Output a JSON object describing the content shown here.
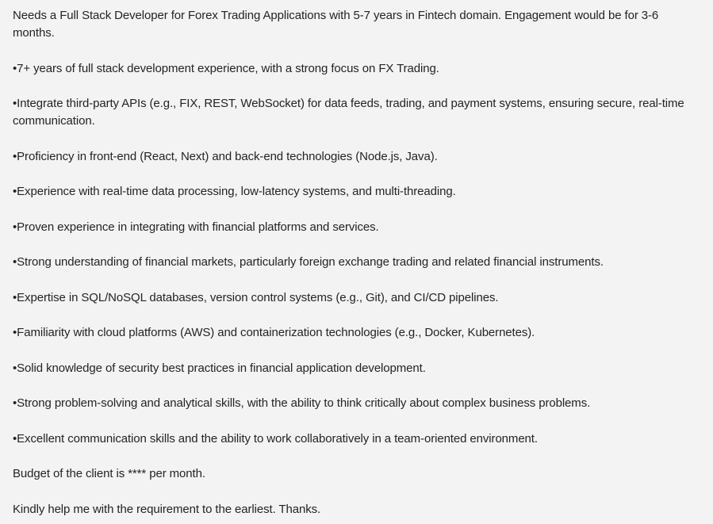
{
  "message": {
    "intro": "Needs a Full Stack Developer for Forex Trading Applications with 5-7 years in Fintech domain. Engagement would be for 3-6 months.",
    "bullet_char": "•",
    "requirements": [
      "7+ years of full stack development experience, with a strong focus on FX Trading.",
      "Integrate third-party APIs (e.g., FIX, REST, WebSocket) for data feeds, trading, and payment systems, ensuring secure, real-time communication.",
      "Proficiency in front-end (React, Next) and back-end technologies (Node.js, Java).",
      "Experience with real-time data processing, low-latency systems, and multi-threading.",
      "Proven experience in integrating with financial platforms and services.",
      "Strong understanding of financial markets, particularly foreign exchange trading and related financial instruments.",
      "Expertise in SQL/NoSQL databases, version control systems (e.g., Git), and CI/CD pipelines.",
      "Familiarity with cloud platforms (AWS) and containerization technologies (e.g., Docker, Kubernetes).",
      "Solid knowledge of security best practices in financial application development.",
      "Strong problem-solving and analytical skills, with the ability to think critically about complex business problems.",
      "Excellent communication skills and the ability to work collaboratively in a team-oriented environment."
    ],
    "budget": "Budget of the client is **** per month.",
    "closing": "Kindly help me with the requirement to the earliest. Thanks."
  }
}
